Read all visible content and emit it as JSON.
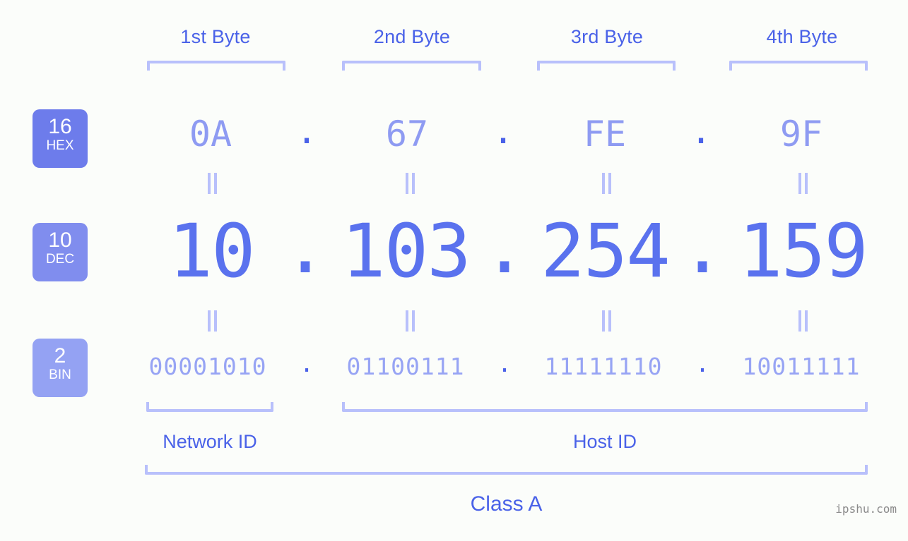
{
  "background_color": "#fbfdfa",
  "accent_color": "#4a62e8",
  "bracket_color": "#b8c0fb",
  "columns": [
    {
      "header": "1st Byte",
      "hex": "0A",
      "dec": "10",
      "bin": "00001010"
    },
    {
      "header": "2nd Byte",
      "hex": "67",
      "dec": "103",
      "bin": "01100111"
    },
    {
      "header": "3rd Byte",
      "hex": "FE",
      "dec": "254",
      "bin": "11111110"
    },
    {
      "header": "4th Byte",
      "hex": "9F",
      "dec": "159",
      "bin": "10011111"
    }
  ],
  "separator": ".",
  "equality_symbol": "=",
  "radix_badges": [
    {
      "number": "16",
      "label": "HEX",
      "color": "#6d7ceb"
    },
    {
      "number": "10",
      "label": "DEC",
      "color": "#808dee"
    },
    {
      "number": "2",
      "label": "BIN",
      "color": "#94a2f3"
    }
  ],
  "regions": {
    "network_id": "Network ID",
    "host_id": "Host ID",
    "class": "Class A"
  },
  "watermark": "ipshu.com",
  "address": {
    "hex": "0A.67.FE.9F",
    "dec": "10.103.254.159",
    "bin": "00001010.01100111.11111110.10011111"
  }
}
